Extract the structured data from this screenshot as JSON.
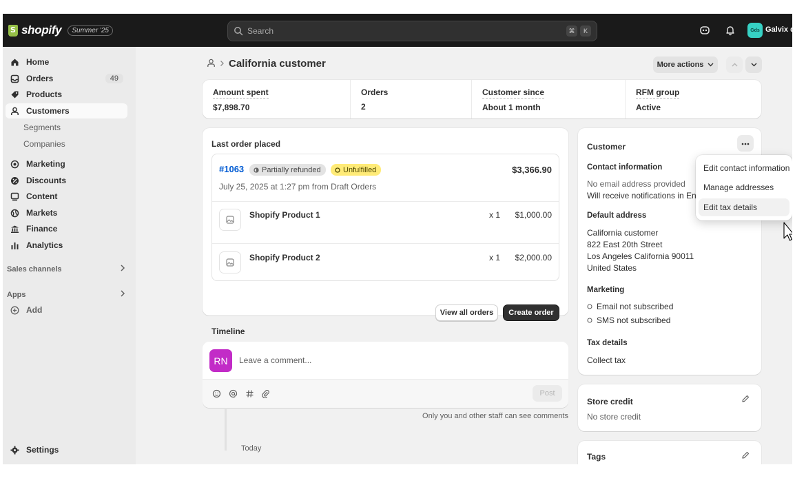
{
  "topbar": {
    "logo_text": "shopify",
    "edition_badge": "Summer '25",
    "search_placeholder": "Search",
    "kbd_cmd": "⌘",
    "kbd_k": "K",
    "store_initials": "Gds",
    "store_name": "Galvix d"
  },
  "sidebar": {
    "items": [
      {
        "label": "Home",
        "icon": "home-icon"
      },
      {
        "label": "Orders",
        "icon": "orders-icon",
        "badge": "49"
      },
      {
        "label": "Products",
        "icon": "tag-icon"
      },
      {
        "label": "Customers",
        "icon": "person-icon",
        "active": true
      }
    ],
    "sub_items": [
      "Segments",
      "Companies"
    ],
    "items2": [
      {
        "label": "Marketing",
        "icon": "target-icon"
      },
      {
        "label": "Discounts",
        "icon": "discount-icon"
      },
      {
        "label": "Content",
        "icon": "content-icon"
      },
      {
        "label": "Markets",
        "icon": "globe-icon"
      },
      {
        "label": "Finance",
        "icon": "bank-icon"
      },
      {
        "label": "Analytics",
        "icon": "bar-chart-icon"
      }
    ],
    "sales_channels": "Sales channels",
    "apps": "Apps",
    "add": "Add",
    "settings": "Settings"
  },
  "header": {
    "title": "California customer",
    "more_actions": "More actions"
  },
  "metrics": [
    {
      "label": "Amount spent",
      "value": "$7,898.70"
    },
    {
      "label": "Orders",
      "value": "2"
    },
    {
      "label": "Customer since",
      "value": "About 1 month"
    },
    {
      "label": "RFM group",
      "value": "Active"
    }
  ],
  "last_order": {
    "heading": "Last order placed",
    "number": "#1063",
    "payment_status": "Partially refunded",
    "fulfillment_status": "Unfulfilled",
    "total": "$3,366.90",
    "meta": "July 25, 2025 at 1:27 pm from Draft Orders",
    "lines": [
      {
        "name": "Shopify Product 1",
        "qty": "x 1",
        "price": "$1,000.00"
      },
      {
        "name": "Shopify Product 2",
        "qty": "x 1",
        "price": "$2,000.00"
      }
    ],
    "view_all": "View all orders",
    "create": "Create order"
  },
  "timeline": {
    "heading": "Timeline",
    "avatar": "RN",
    "placeholder": "Leave a comment...",
    "post": "Post",
    "note": "Only you and other staff can see comments",
    "today": "Today"
  },
  "customer": {
    "heading": "Customer",
    "contact_heading": "Contact information",
    "email": "No email address provided",
    "notifications": "Will receive notifications in Eng",
    "address_heading": "Default address",
    "address": [
      "California customer",
      "822 East 20th Street",
      "Los Angeles California 90011",
      "United States"
    ],
    "marketing_heading": "Marketing",
    "email_marketing": "Email not subscribed",
    "sms_marketing": "SMS not subscribed",
    "tax_heading": "Tax details",
    "tax_value": "Collect tax"
  },
  "store_credit": {
    "heading": "Store credit",
    "value": "No store credit"
  },
  "tags": {
    "heading": "Tags"
  },
  "popover": {
    "items": [
      "Edit contact information",
      "Manage addresses",
      "Edit tax details"
    ],
    "hovered": 2
  },
  "colors": {
    "topbar": "#1a1a1a",
    "link": "#005bd3",
    "unfulfilled_badge": "#ffeb78",
    "avatar_rn": "#c22bc7",
    "store_avatar": "#36d1c4"
  }
}
